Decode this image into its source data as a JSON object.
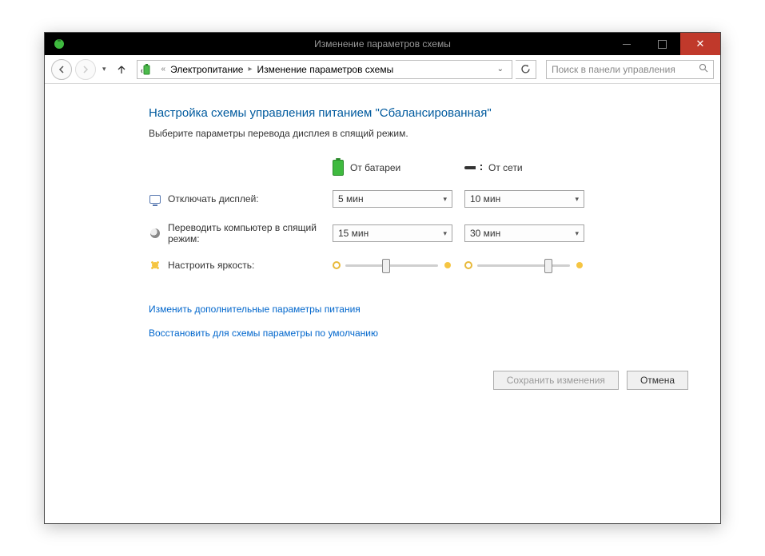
{
  "titlebar": {
    "title": "Изменение параметров схемы"
  },
  "breadcrumb": {
    "item1": "Электропитание",
    "item2": "Изменение параметров схемы"
  },
  "search": {
    "placeholder": "Поиск в панели управления"
  },
  "page": {
    "heading": "Настройка схемы управления питанием \"Сбалансированная\"",
    "subtext": "Выберите параметры перевода дисплея в спящий режим."
  },
  "columns": {
    "battery": "От батареи",
    "plugged": "От сети"
  },
  "rows": {
    "display_off": {
      "label": "Отключать дисплей:",
      "battery": "5 мин",
      "plugged": "10 мин"
    },
    "sleep": {
      "label": "Переводить компьютер в спящий режим:",
      "battery": "15 мин",
      "plugged": "30 мин"
    },
    "brightness": {
      "label": "Настроить яркость:",
      "battery_pct": 40,
      "plugged_pct": 72
    }
  },
  "links": {
    "advanced": "Изменить дополнительные параметры питания",
    "restore": "Восстановить для схемы параметры по умолчанию"
  },
  "buttons": {
    "save": "Сохранить изменения",
    "cancel": "Отмена"
  }
}
